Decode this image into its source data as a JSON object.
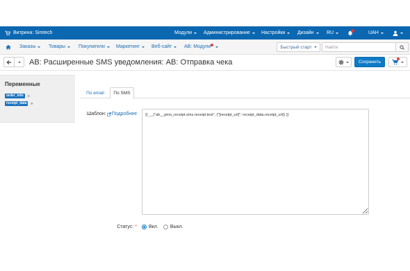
{
  "colors": {
    "topbar_bg": "#0c67b1",
    "accent": "#0e7ac6",
    "link": "#1b6db5",
    "red": "#e0393b",
    "badge": "#1a72bd"
  },
  "topbar": {
    "store_icon": "cart-icon",
    "store_label": "Витрина: Simtech",
    "menus": [
      "Модули",
      "Администрирование",
      "Настройки",
      "Дизайн",
      "RU"
    ],
    "notifications_icon": "bell-icon",
    "currency": "UAH",
    "user_icon": "user-icon"
  },
  "navbar": {
    "home_icon": "home-icon",
    "items": [
      "Заказы",
      "Товары",
      "Покупатели",
      "Маркетинг",
      "Веб-сайт",
      "AB: Модули"
    ],
    "quick_start": "Быстрый старт",
    "search": {
      "placeholder": "Найти",
      "icon": "search-icon"
    }
  },
  "header": {
    "back_icon": "arrow-left-icon",
    "title": "AB: Расширенные SMS уведомления: AB: Отправка чека",
    "settings_icon": "gear-icon",
    "save_label": "Сохранить",
    "storefront_icon": "cart-icon"
  },
  "sidebar": {
    "title": "Переменные",
    "variables": [
      {
        "name": "order_info",
        "add": "+"
      },
      {
        "name": "receipt_data",
        "add": "+"
      }
    ]
  },
  "tabs": [
    {
      "label": "По email",
      "active": false
    },
    {
      "label": "По SMS",
      "active": true
    }
  ],
  "form": {
    "template": {
      "label": "Шаблон:",
      "help_icon": "external-link-icon",
      "help_link": "Подробнее",
      "value": "{{ __(\"ab__pmo_receipt.sms.receipt.text\", {\"[receipt_url]\": receipt_data.receipt_url}) }}"
    },
    "status": {
      "label": "Статус:",
      "required_mark": "*",
      "options": [
        {
          "label": "Вкл.",
          "checked": true
        },
        {
          "label": "Выкл.",
          "checked": false
        }
      ]
    }
  }
}
